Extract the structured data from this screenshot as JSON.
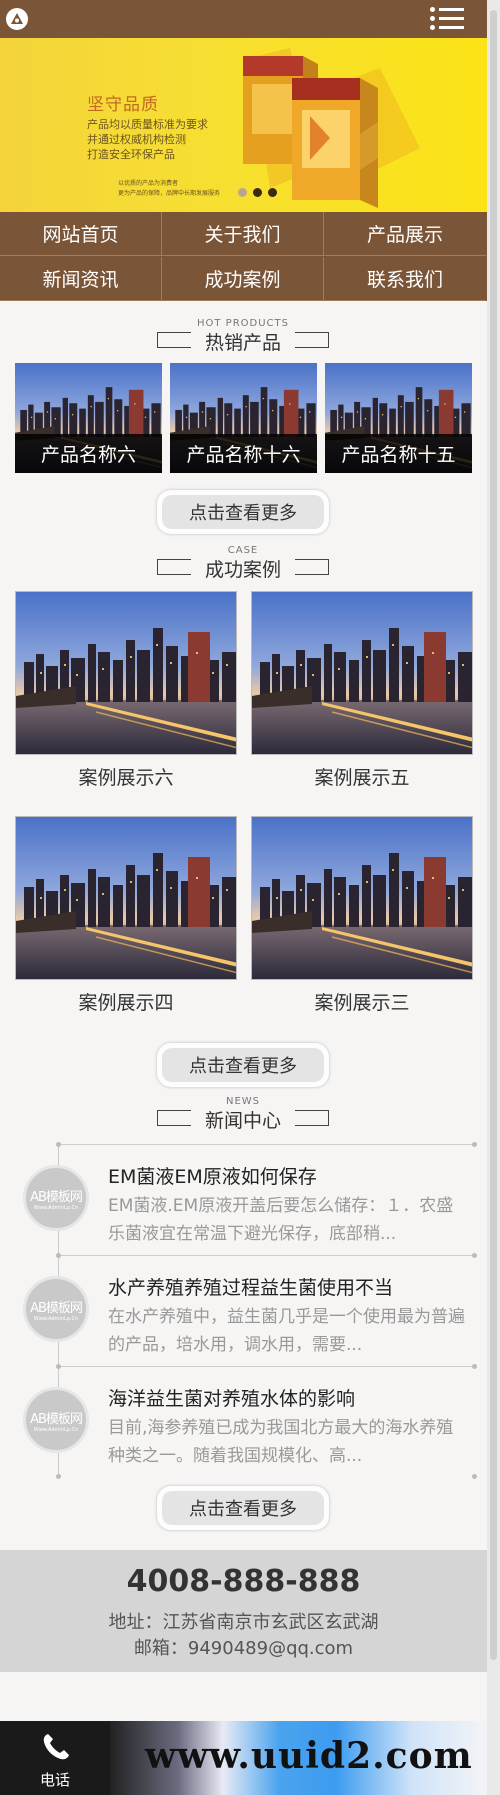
{
  "header": {
    "logo_icon": "logo-icon",
    "menu_icon": "menu-icon"
  },
  "banner": {
    "title": "坚守品质",
    "lines": [
      "产品均以质量标准为要求",
      "并通过权威机构检测",
      "打造安全环保产品"
    ],
    "small": [
      "以优质的产品为消费者",
      "更为产品的保障，品牌中长期发展服务"
    ],
    "slide_dots": 3,
    "active_dot": 1
  },
  "nav": {
    "items": [
      "网站首页",
      "关于我们",
      "产品展示",
      "新闻资讯",
      "成功案例",
      "联系我们"
    ]
  },
  "hot_products": {
    "title_en": "HOT PRODUCTS",
    "title_cn": "热销产品",
    "items": [
      "产品名称六",
      "产品名称十六",
      "产品名称十五"
    ],
    "more": "点击查看更多"
  },
  "cases": {
    "title_en": "CASE",
    "title_cn": "成功案例",
    "items": [
      "案例展示六",
      "案例展示五",
      "案例展示四",
      "案例展示三"
    ],
    "more": "点击查看更多"
  },
  "news": {
    "title_en": "NEWS",
    "title_cn": "新闻中心",
    "avatar_text": "AB模板网",
    "avatar_sub": "Www.AdminLp.Cn",
    "items": [
      {
        "title": "EM菌液EM原液如何保存",
        "desc": "EM菌液.EM原液开盖后要怎么储存：１．农盛乐菌液宜在常温下避光保存，底部稍..."
      },
      {
        "title": "水产养殖养殖过程益生菌使用不当",
        "desc": "在水产养殖中，益生菌几乎是一个使用最为普遍的产品，培水用，调水用，需要..."
      },
      {
        "title": "海洋益生菌对养殖水体的影响",
        "desc": "目前,海参养殖已成为我国北方最大的海水养殖种类之一。随着我国规模化、高..."
      }
    ],
    "more": "点击查看更多"
  },
  "footer": {
    "phone": "4008-888-888",
    "address": "地址：江苏省南京市玄武区玄武湖",
    "email": "邮箱：9490489@qq.com"
  },
  "bottom_bar": {
    "call_label": "电话",
    "watermark": "www.uuid2.com"
  }
}
